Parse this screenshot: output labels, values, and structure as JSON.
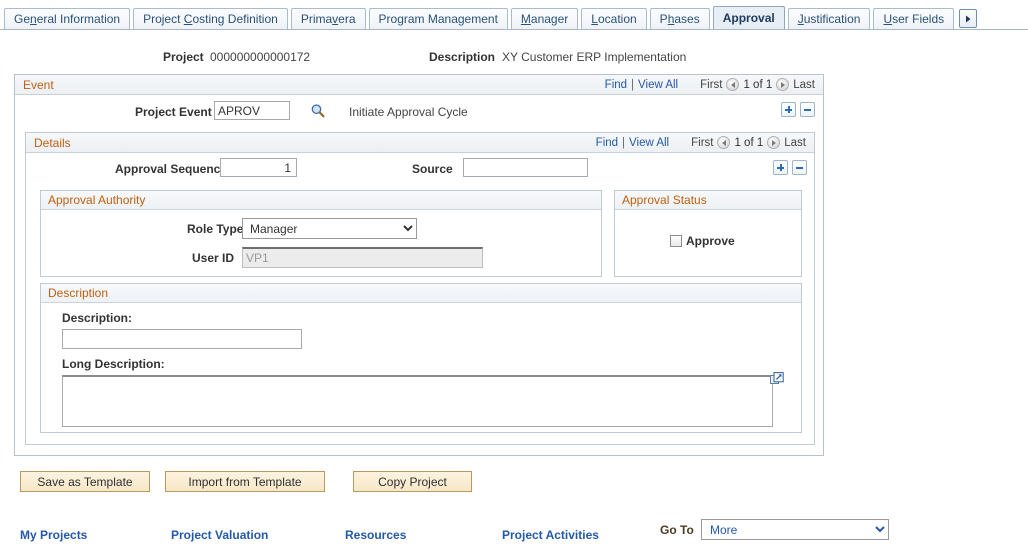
{
  "tabs": [
    {
      "label": "General Information",
      "accel": "n",
      "active": false
    },
    {
      "label": "Project Costing Definition",
      "accel": "C",
      "active": false
    },
    {
      "label": "Primavera",
      "accel": "v",
      "active": false
    },
    {
      "label": "Program Management",
      "accel": "",
      "active": false
    },
    {
      "label": "Manager",
      "accel": "M",
      "active": false
    },
    {
      "label": "Location",
      "accel": "L",
      "active": false
    },
    {
      "label": "Phases",
      "accel": "h",
      "active": false
    },
    {
      "label": "Approval",
      "accel": "",
      "active": true
    },
    {
      "label": "Justification",
      "accel": "J",
      "active": false
    },
    {
      "label": "User Fields",
      "accel": "U",
      "active": false
    }
  ],
  "tab_more_icon": "chevron-right-icon",
  "project_header": {
    "project_label": "Project",
    "project_value": "000000000000172",
    "description_label": "Description",
    "description_value": "XY Customer ERP Implementation"
  },
  "event": {
    "title": "Event",
    "nav": {
      "find": "Find",
      "separator": "|",
      "view_all": "View All",
      "first": "First",
      "counter": "1 of 1",
      "last": "Last"
    },
    "project_event_label": "Project Event",
    "project_event_value": "APROV",
    "lookup_icon": "search-icon",
    "event_description": "Initiate Approval Cycle",
    "add_row_icon": "plus-icon",
    "delete_row_icon": "minus-icon"
  },
  "details": {
    "title": "Details",
    "nav": {
      "find": "Find",
      "separator": "|",
      "view_all": "View All",
      "first": "First",
      "counter": "1 of 1",
      "last": "Last"
    },
    "approval_sequence_label": "Approval Sequence",
    "approval_sequence_value": "1",
    "source_label": "Source",
    "source_value": "",
    "add_row_icon": "plus-icon",
    "delete_row_icon": "minus-icon"
  },
  "approval_authority": {
    "title": "Approval Authority",
    "role_type_label": "Role Type",
    "role_type_value": "Manager",
    "role_type_options": [
      "Manager"
    ],
    "user_id_label": "User ID",
    "user_id_value": "VP1"
  },
  "approval_status": {
    "title": "Approval Status",
    "approve_label": "Approve",
    "approve_checked": false
  },
  "description_section": {
    "title": "Description",
    "description_label": "Description:",
    "description_value": "",
    "long_description_label": "Long Description:",
    "long_description_value": "",
    "expand_icon": "expand-popup-icon"
  },
  "action_buttons": [
    {
      "label": "Save as Template"
    },
    {
      "label": "Import from Template"
    },
    {
      "label": "Copy Project"
    }
  ],
  "bottom_links": [
    {
      "label": "My Projects"
    },
    {
      "label": "Project Valuation"
    },
    {
      "label": "Resources"
    },
    {
      "label": "Project Activities"
    }
  ],
  "goto": {
    "label": "Go To",
    "value": "More",
    "options": [
      "More"
    ]
  },
  "colors": {
    "group_title": "#c06010",
    "link": "#2458a8",
    "button_face": "#f7e7c8",
    "tab_active_bg": "#e8eef6"
  }
}
